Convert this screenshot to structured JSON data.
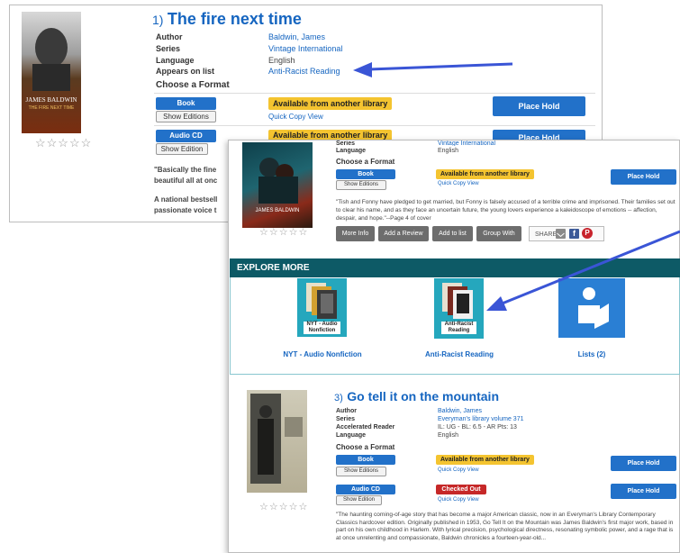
{
  "result1": {
    "number": "1)",
    "title": "The fire next time",
    "cover": {
      "author": "JAMES BALDWIN",
      "subtitle": "THE FIRE NEXT TIME"
    },
    "rating": "☆☆☆☆☆",
    "details": [
      {
        "label": "Author",
        "value": "Baldwin, James"
      },
      {
        "label": "Series",
        "value": "Vintage International"
      },
      {
        "label": "Language",
        "value": "English"
      },
      {
        "label": "Appears on list",
        "value": "Anti-Racist Reading"
      }
    ],
    "choose_format": "Choose a Format",
    "formats": [
      {
        "name": "Book",
        "editions": "Show Editions",
        "status": "Available from another library",
        "quick_copy": "Quick Copy View",
        "action": "Place Hold"
      },
      {
        "name": "Audio CD",
        "editions": "Show Edition",
        "status": "Available from another library",
        "action": "Place Hold"
      }
    ],
    "description": [
      "\"Basically the fine",
      "beautiful all at onc",
      "",
      "A national bestsell",
      "passionate voice t"
    ]
  },
  "result2": {
    "cover_author": "JAMES BALDWIN",
    "rating": "☆☆☆☆☆",
    "details": [
      {
        "label": "Series",
        "value": "Vintage International"
      },
      {
        "label": "Language",
        "value": "English"
      }
    ],
    "choose_format": "Choose a Format",
    "format": {
      "name": "Book",
      "editions": "Show Editions",
      "status": "Available from another library",
      "quick_copy": "Quick Copy View",
      "action": "Place Hold"
    },
    "description": "\"Tish and Fonny have pledged to get married, but Fonny is falsely accused of a terrible crime and imprisoned. Their families set out to clear his name, and as they face an uncertain future, the young lovers experience a kaleidoscope of emotions -- affection, despair, and hope.\"--Page 4 of cover",
    "actions": [
      "More Info",
      "Add a Review",
      "Add to list",
      "Group With"
    ],
    "share_label": "SHARE"
  },
  "explore": {
    "heading": "EXPLORE MORE",
    "items": [
      {
        "caption": "NYT - Audio Nonfiction",
        "label": "NYT - Audio Nonfiction"
      },
      {
        "caption": "Anti-Racist Reading",
        "label": "Anti-Racist Reading"
      },
      {
        "caption": "",
        "label": "Lists (2)"
      }
    ]
  },
  "result3": {
    "number": "3)",
    "title": "Go tell it on the mountain",
    "rating": "☆☆☆☆☆",
    "details": [
      {
        "label": "Author",
        "value": "Baldwin, James"
      },
      {
        "label": "Series",
        "value": "Everyman's library volume 371"
      },
      {
        "label": "Accelerated Reader",
        "value": "IL: UG - BL: 6.5 - AR Pts: 13"
      },
      {
        "label": "Language",
        "value": "English"
      }
    ],
    "choose_format": "Choose a Format",
    "formats": [
      {
        "name": "Book",
        "editions": "Show Editions",
        "status": "Available from another library",
        "quick_copy": "Quick Copy View",
        "action": "Place Hold"
      },
      {
        "name": "Audio CD",
        "editions": "Show Edition",
        "status": "Checked Out",
        "quick_copy": "Quick Copy View",
        "action": "Place Hold"
      }
    ],
    "description": "\"The haunting coming-of-age story that has become a major American classic, now in an Everyman's Library Contemporary Classics hardcover edition. Originally published in 1953, Go Tell It on the Mountain was James Baldwin's first major work, based in part on his own childhood in Harlem. With lyrical precision, psychological directness, resonating symbolic power, and a rage that is at once unrelenting and compassionate, Baldwin chronicles a fourteen-year-old..."
  },
  "colors": {
    "link": "#1565c0",
    "button": "#2271c9",
    "available": "#f4c430",
    "checked_out": "#c62828",
    "explore_bar": "#0d5a66",
    "arrow": "#3a55d6"
  }
}
